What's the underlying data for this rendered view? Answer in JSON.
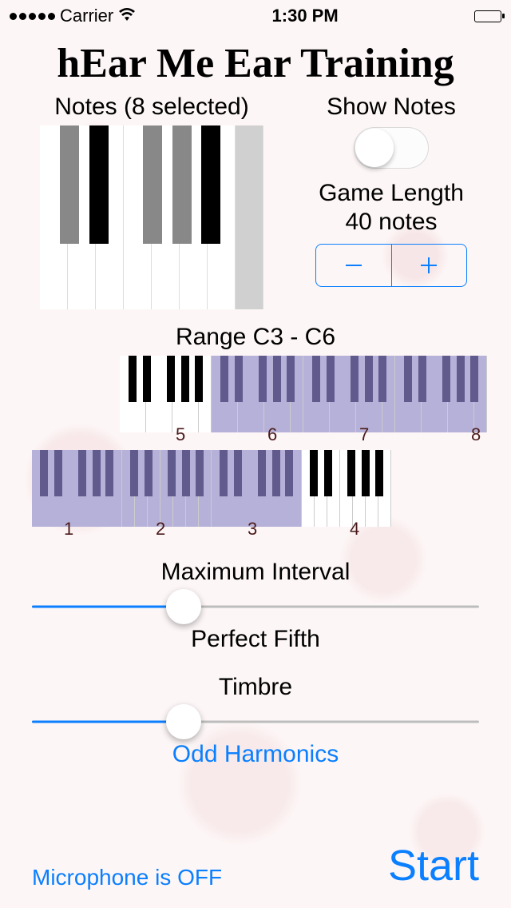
{
  "statusbar": {
    "carrier": "Carrier",
    "time": "1:30 PM"
  },
  "app_title": "hEar Me Ear Training",
  "notes": {
    "label": "Notes (8 selected)",
    "white_selected": [
      false,
      false,
      false,
      false,
      false,
      false,
      false,
      true
    ],
    "black_on": [
      false,
      true,
      false,
      false,
      true
    ]
  },
  "show_notes": {
    "label": "Show Notes",
    "on": false
  },
  "game_length": {
    "label": "Game Length",
    "value": "40 notes"
  },
  "range": {
    "label": "Range C3 - C6",
    "row1_labels": [
      "5",
      "6",
      "7",
      "8"
    ],
    "row2_labels": [
      "1",
      "2",
      "3",
      "4"
    ]
  },
  "max_interval": {
    "label": "Maximum Interval",
    "value_label": "Perfect Fifth",
    "percent": 34
  },
  "timbre": {
    "label": "Timbre",
    "value_label": "Odd Harmonics",
    "percent": 34
  },
  "mic_label": "Microphone is OFF",
  "start_label": "Start"
}
